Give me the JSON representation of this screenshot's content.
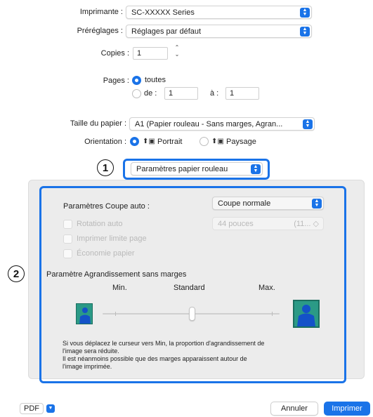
{
  "printer": {
    "label": "Imprimante :",
    "value": "SC-XXXXX Series"
  },
  "presets": {
    "label": "Préréglages :",
    "value": "Réglages par défaut"
  },
  "copies": {
    "label": "Copies :",
    "value": "1"
  },
  "pages": {
    "label": "Pages :",
    "all_label": "toutes",
    "from_label": "de :",
    "from_value": "1",
    "to_label": "à :",
    "to_value": "1"
  },
  "paper_size": {
    "label": "Taille du papier :",
    "value": "A1 (Papier rouleau - Sans marges, Agran..."
  },
  "orientation": {
    "label": "Orientation :",
    "portrait": "Portrait",
    "landscape": "Paysage"
  },
  "section_menu": {
    "value": "Paramètres papier rouleau"
  },
  "callouts": {
    "one": "1",
    "two": "2"
  },
  "auto_cut": {
    "label": "Paramètres Coupe auto :",
    "value": "Coupe normale"
  },
  "auto_rotation": {
    "label": "Rotation auto",
    "size_value": "44 pouces",
    "size_suffix": "(11... ◇"
  },
  "print_page_line": {
    "label": "Imprimer limite page"
  },
  "paper_saving": {
    "label": "Économie papier"
  },
  "expansion": {
    "title": "Paramètre Agrandissement sans marges",
    "min": "Min.",
    "standard": "Standard",
    "max": "Max.",
    "slider_level": "standard",
    "note_1": "Si vous déplacez le curseur vers Min, la proportion d'agrandissement de",
    "note_2": "l'image sera réduite.",
    "note_3": "Il est néanmoins possible que des marges apparaissent autour de",
    "note_4": "l'image imprimée."
  },
  "footer": {
    "pdf": "PDF",
    "cancel": "Annuler",
    "print": "Imprimer"
  },
  "colors": {
    "accent": "#1a73e8",
    "figure_bg": "#2b9a86",
    "figure_person": "#1452c8"
  }
}
